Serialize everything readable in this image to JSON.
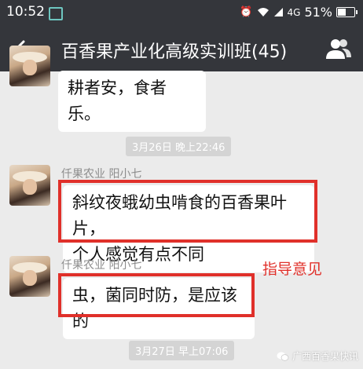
{
  "status_bar": {
    "time": "10:52",
    "network": "4G",
    "battery_percent_text": "51%",
    "battery_level": 0.51
  },
  "title_bar": {
    "title": "百香果产业化高级实训班(45)",
    "icons": {
      "back": "back-arrow-icon",
      "group": "group-members-icon"
    }
  },
  "messages": [
    {
      "type": "text",
      "text": "耕者安，食者乐。"
    },
    {
      "type": "timestamp",
      "text": "3月26日 晚上22:46"
    },
    {
      "type": "text",
      "sender": "仟果农业 阳小七",
      "lines": [
        "斜纹夜蛾幼虫啃食的百香果叶片，",
        "个人感觉有点不同"
      ]
    },
    {
      "type": "text",
      "sender": "仟果农业 阳小七",
      "text": "虫，菌同时防，是应该的"
    },
    {
      "type": "timestamp",
      "text": "3月27日 早上07:06"
    }
  ],
  "annotation": {
    "text": "指导意见",
    "color": "#e0302a"
  },
  "watermark": {
    "text": "广西百香果快讯"
  },
  "colors": {
    "bar": "#34363b",
    "chat_bg": "#ebebeb",
    "highlight": "#e0302a"
  }
}
